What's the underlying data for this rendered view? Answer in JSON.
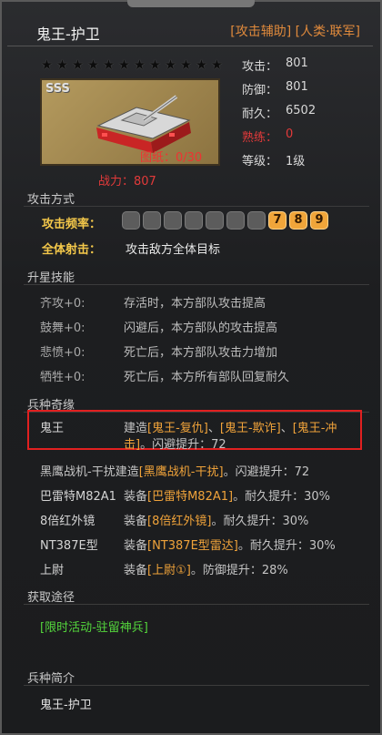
{
  "header": {
    "title": "鬼王-护卫",
    "tag_support": "[攻击辅助]",
    "tag_faction": "[人类·联军]"
  },
  "card": {
    "rarity": "SSS",
    "blueprint": "图纸：0/30",
    "power": "战力：807",
    "star_count": 12
  },
  "stats": [
    {
      "label": "攻击：",
      "value": "801"
    },
    {
      "label": "防御：",
      "value": "801"
    },
    {
      "label": "耐久：",
      "value": "6502"
    },
    {
      "label": "熟练：",
      "value": "0"
    },
    {
      "label": "等级：",
      "value": "1级"
    }
  ],
  "attack": {
    "section": "攻击方式",
    "freq_label": "攻击频率：",
    "freq_levels": [
      "7",
      "8",
      "9"
    ],
    "aoe_label": "全体射击：",
    "aoe_desc": "攻击敌方全体目标"
  },
  "skills": {
    "section": "升星技能",
    "items": [
      {
        "name": "齐攻+0:",
        "desc": "存活时，本方部队攻击提高"
      },
      {
        "name": "鼓舞+0:",
        "desc": "闪避后，本方部队的攻击提高"
      },
      {
        "name": "悲愤+0:",
        "desc": "死亡后，本方部队攻击力增加"
      },
      {
        "name": "牺牲+0:",
        "desc": "死亡后，本方所有部队回复耐久"
      }
    ]
  },
  "bonds": {
    "section": "兵种奇缘",
    "r1_name": "鬼王",
    "r1_pre": "建造",
    "r1_link1": "[鬼王-复仇]",
    "r1_sep1": "、",
    "r1_link2": "[鬼王-欺诈]",
    "r1_sep2": "、",
    "r1_link3a": "[鬼王-冲",
    "r1_link3b": "击]",
    "r1_tail": "。闪避提升：72",
    "r2_name": "黑鹰战机-干扰",
    "r2_pre": "建造",
    "r2_link": "[黑鹰战机-干扰]",
    "r2_tail": "。闪避提升：72",
    "r3_name": "巴雷特M82A1",
    "r3_pre": "装备",
    "r3_link": "[巴雷特M82A1]",
    "r3_tail": "。耐久提升：30%",
    "r4_name": "8倍红外镜",
    "r4_pre": "装备",
    "r4_link": "[8倍红外镜]",
    "r4_tail": "。耐久提升：30%",
    "r5_name": "NT387E型",
    "r5_pre": "装备",
    "r5_link": "[NT387E型雷达]",
    "r5_tail": "。耐久提升：30%",
    "r6_name": "上尉",
    "r6_pre": "装备",
    "r6_link": "[上尉①]",
    "r6_tail": "。防御提升：28%"
  },
  "obtain": {
    "section": "获取途径",
    "value": "[限时活动-驻留神兵]"
  },
  "intro": {
    "section": "兵种简介",
    "value": "鬼王-护卫"
  },
  "colors": {
    "accent_orange": "#f0a33a",
    "link_yellow": "#f4c84a",
    "red": "#e23a3a",
    "green": "#54d63c",
    "highlight_box": "#e12020"
  }
}
